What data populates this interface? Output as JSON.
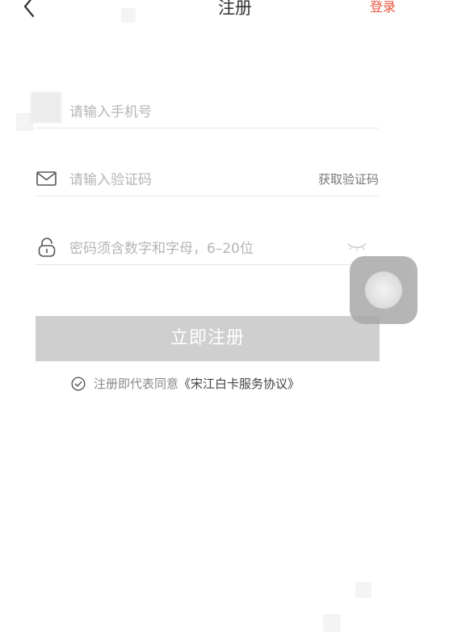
{
  "header": {
    "title": "注册",
    "login_label": "登录"
  },
  "fields": {
    "phone": {
      "placeholder": "请输入手机号"
    },
    "code": {
      "placeholder": "请输入验证码",
      "get_code_label": "获取验证码"
    },
    "password": {
      "placeholder": "密码须含数字和字母，6–20位"
    }
  },
  "submit": {
    "label": "立即注册"
  },
  "agreement": {
    "prefix": "注册即代表同意",
    "link": "《宋江白卡服务协议》"
  },
  "icons": {
    "back": "chevron-left-icon",
    "mail": "mail-icon",
    "lock": "lock-icon",
    "eye": "eye-closed-icon",
    "check": "check-circle-icon"
  },
  "colors": {
    "accent": "#e8553e",
    "button_disabled": "#cfcfcf"
  }
}
